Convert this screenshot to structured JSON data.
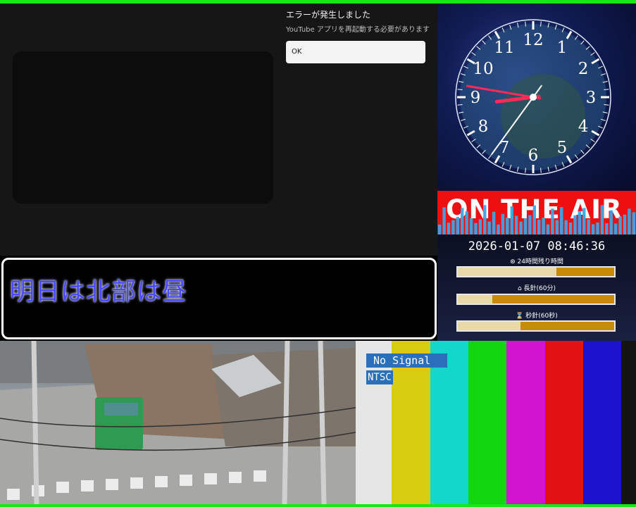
{
  "youtube_error": {
    "title": "エラーが発生しました",
    "message": "YouTube アプリを再起動する必要があります",
    "ok_label": "OK"
  },
  "caption": {
    "text": "明日は北部は昼"
  },
  "clock": {
    "numerals": [
      "12",
      "1",
      "2",
      "3",
      "4",
      "5",
      "6",
      "7",
      "8",
      "9",
      "10",
      "11"
    ],
    "time": "08:46:36"
  },
  "on_air": {
    "label": "ON THE AIR"
  },
  "timer": {
    "datetime": "2026-01-07 08:46:36",
    "remaining_24h_label": "24時間残り時間",
    "minute_hand_label": "長針(60分)",
    "second_hand_label": "秒針(60秒)",
    "remaining_24h_fraction": 0.63,
    "minute_hand_fraction": 0.22,
    "second_hand_fraction": 0.4
  },
  "signal": {
    "no_signal": "No Signal",
    "standard": "NTSC"
  },
  "colors": {
    "frame": "#19e619",
    "on_air_bg": "#ee1010",
    "caption_text": "#4949ff",
    "color_bars": [
      "#e6e6e6",
      "#d8cc10",
      "#12d8cc",
      "#12d60f",
      "#d114d0",
      "#e01212",
      "#1c14cc",
      "#141414"
    ]
  }
}
